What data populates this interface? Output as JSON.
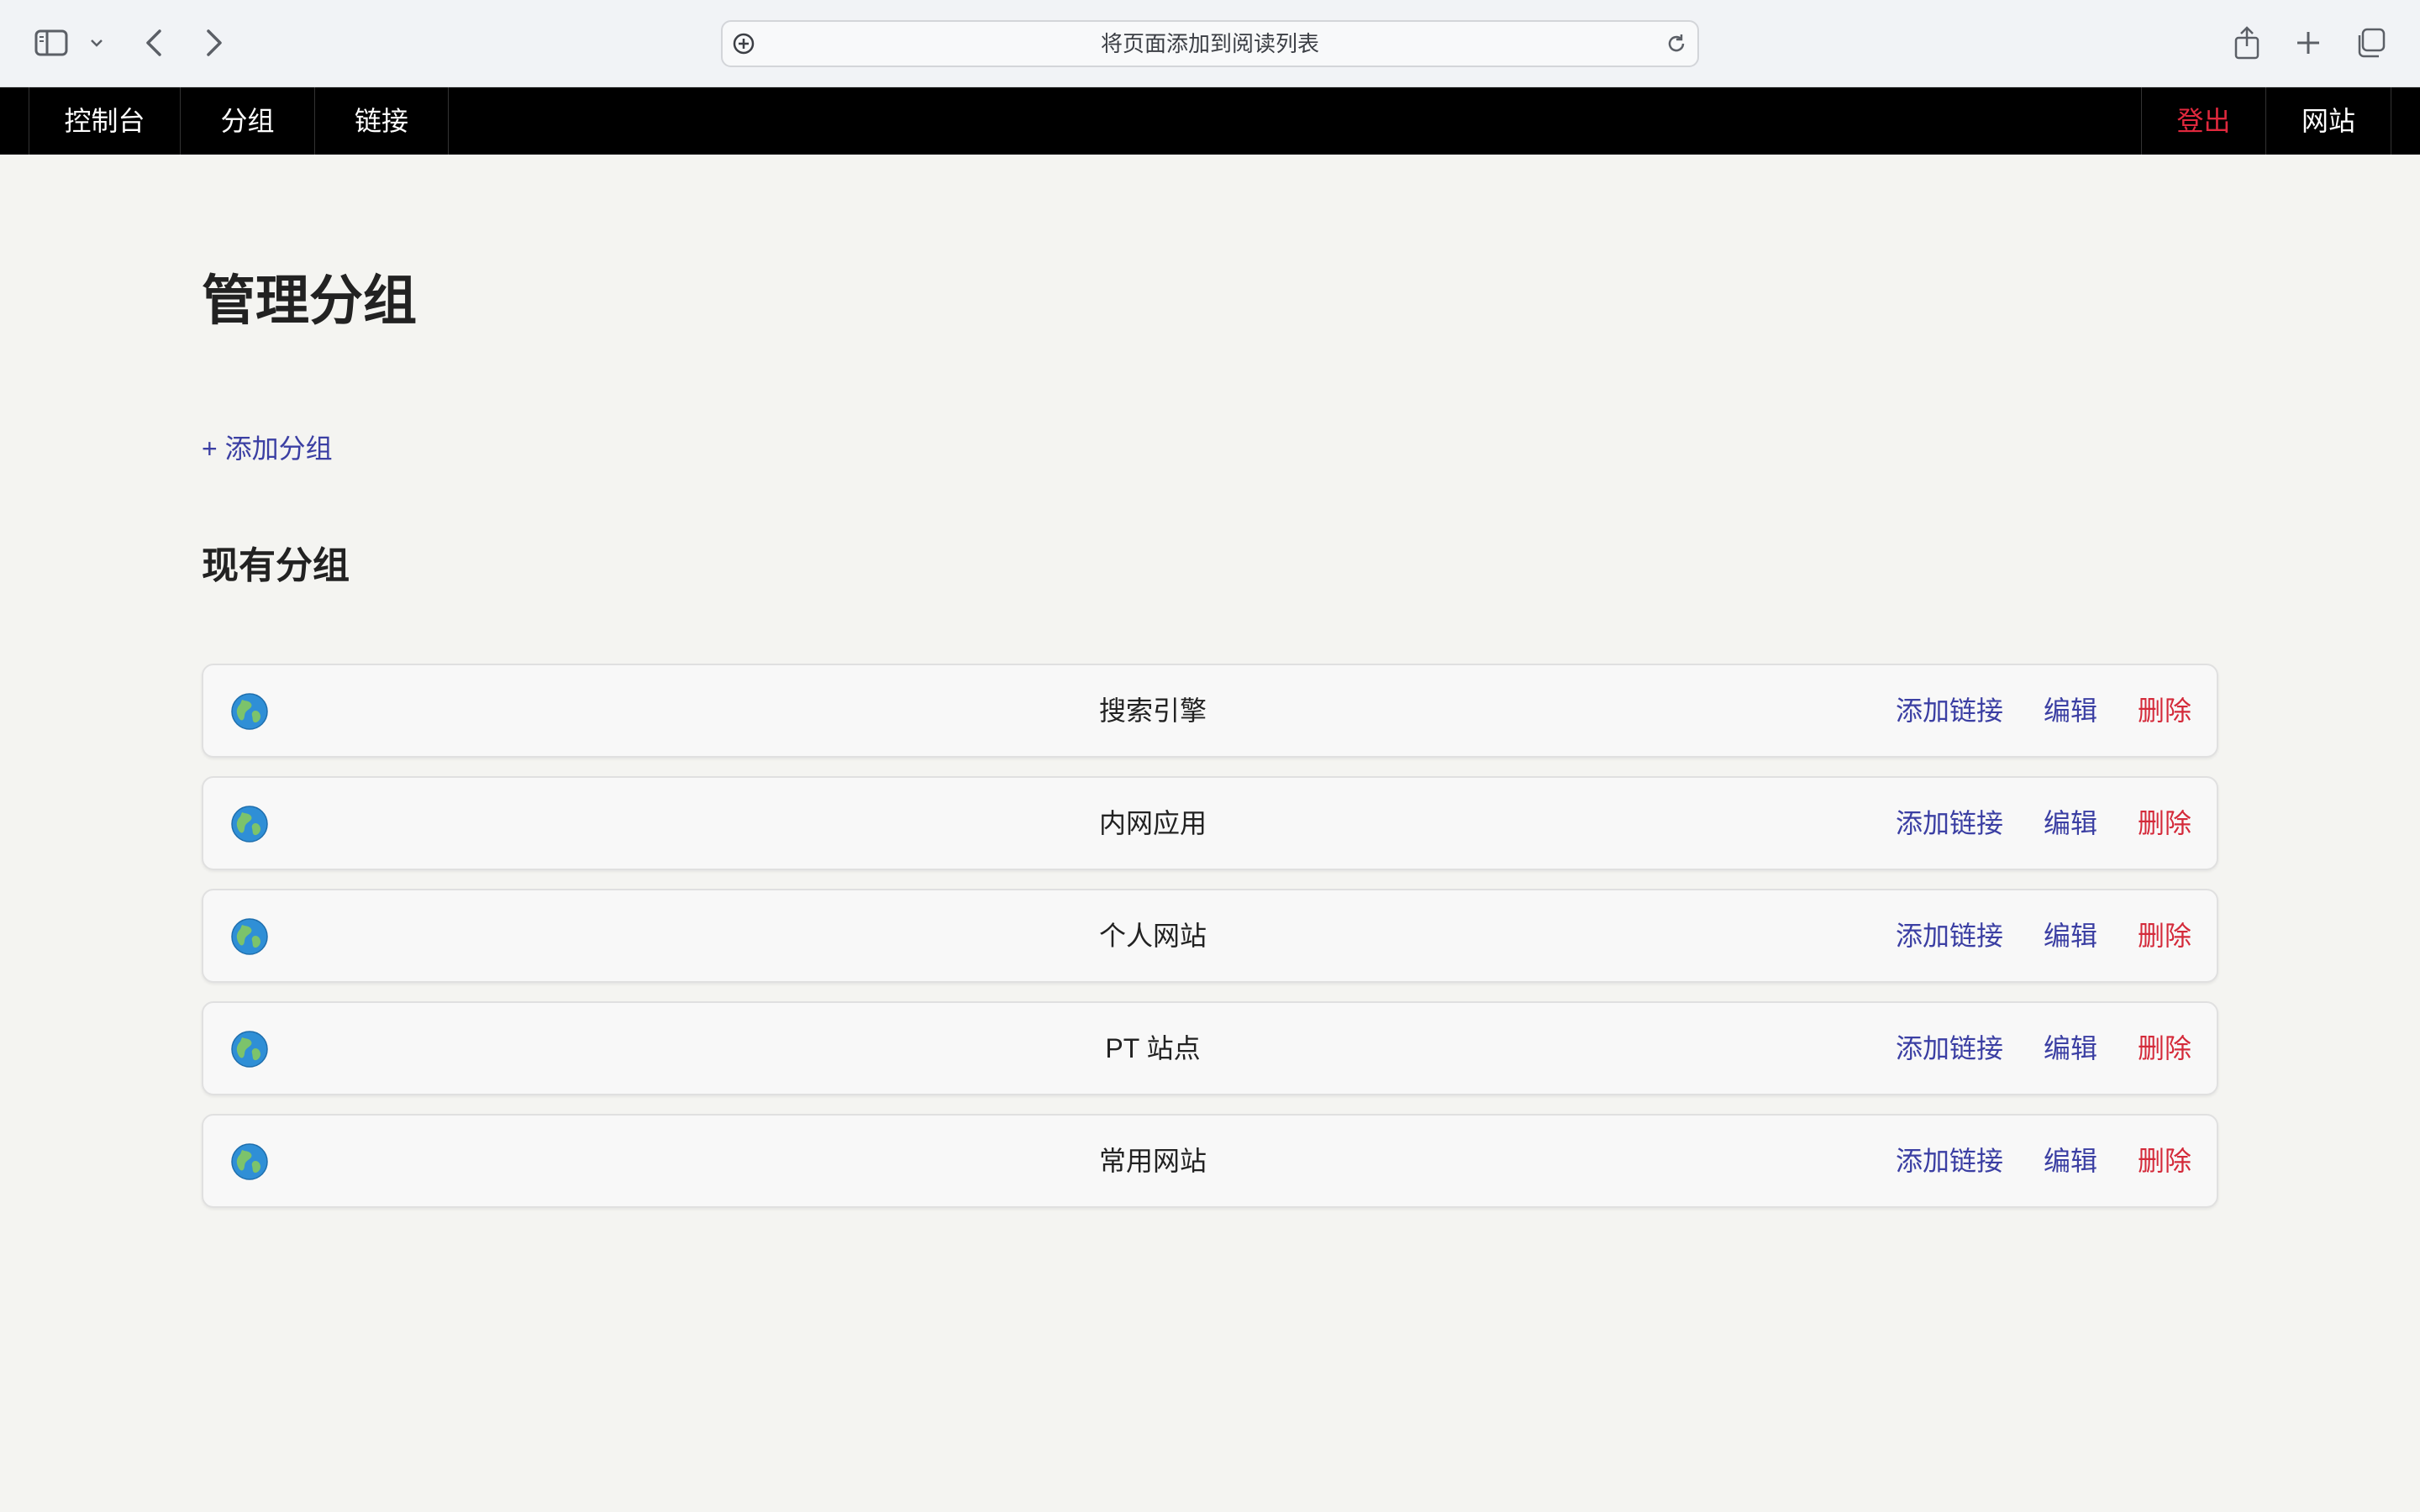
{
  "browser": {
    "address_text": "将页面添加到阅读列表"
  },
  "nav": {
    "left": [
      "控制台",
      "分组",
      "链接"
    ],
    "logout": "登出",
    "site": "网站"
  },
  "page": {
    "title": "管理分组",
    "add_group": "+ 添加分组",
    "section_title": "现有分组"
  },
  "groups": [
    {
      "name": "搜索引擎",
      "icon": "globe-icon"
    },
    {
      "name": "内网应用",
      "icon": "globe-icon"
    },
    {
      "name": "个人网站",
      "icon": "globe-icon"
    },
    {
      "name": "PT 站点",
      "icon": "globe-icon"
    },
    {
      "name": "常用网站",
      "icon": "globe-icon"
    }
  ],
  "actions": {
    "add_link": "添加链接",
    "edit": "编辑",
    "delete": "删除"
  },
  "colors": {
    "nav_bg": "#000000",
    "link": "#3b3fa3",
    "danger": "#d42a3a",
    "page_bg": "#f4f4f1"
  }
}
